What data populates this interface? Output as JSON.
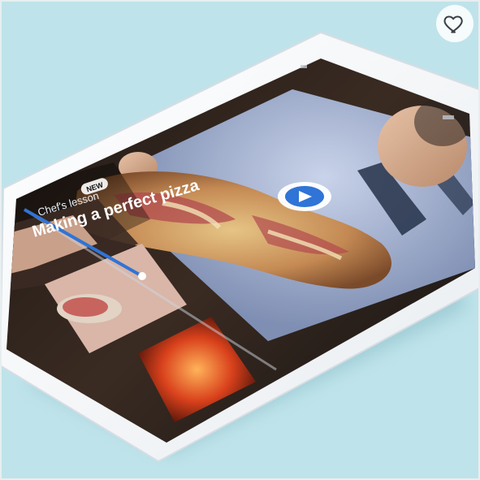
{
  "product_card": {
    "favorite_icon": "heart-outline-icon",
    "device": {
      "lesson_badge": "NEW",
      "lesson_subtitle": "Chef's lesson",
      "lesson_title": "Making a perfect pizza",
      "time_elapsed": "",
      "time_total": "",
      "play_icon": "play-icon"
    }
  },
  "colors": {
    "background": "#bfe3ea",
    "device_body": "#f6f7f9",
    "accent_blue": "#2f74d6"
  }
}
